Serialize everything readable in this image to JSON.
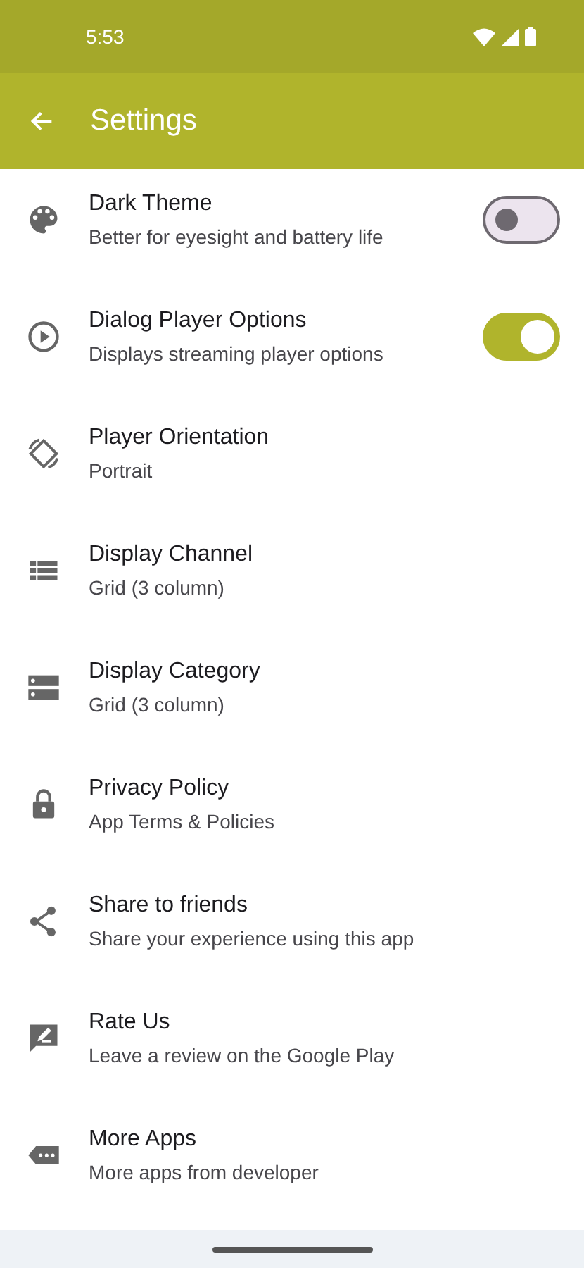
{
  "status_bar": {
    "time": "5:53"
  },
  "app_bar": {
    "title": "Settings"
  },
  "settings": [
    {
      "kind": "toggle",
      "title": "Dark Theme",
      "subtitle": "Better for eyesight and battery life",
      "on": false
    },
    {
      "kind": "toggle",
      "title": "Dialog Player Options",
      "subtitle": "Displays streaming player options",
      "on": true
    },
    {
      "kind": "link",
      "title": "Player Orientation",
      "subtitle": "Portrait"
    },
    {
      "kind": "link",
      "title": "Display Channel",
      "subtitle": "Grid (3 column)"
    },
    {
      "kind": "link",
      "title": "Display Category",
      "subtitle": "Grid (3 column)"
    },
    {
      "kind": "link",
      "title": "Privacy Policy",
      "subtitle": "App Terms & Policies"
    },
    {
      "kind": "link",
      "title": "Share to friends",
      "subtitle": "Share your experience using this app"
    },
    {
      "kind": "link",
      "title": "Rate Us",
      "subtitle": "Leave a review on the Google Play"
    },
    {
      "kind": "link",
      "title": "More Apps",
      "subtitle": "More apps from developer"
    }
  ]
}
